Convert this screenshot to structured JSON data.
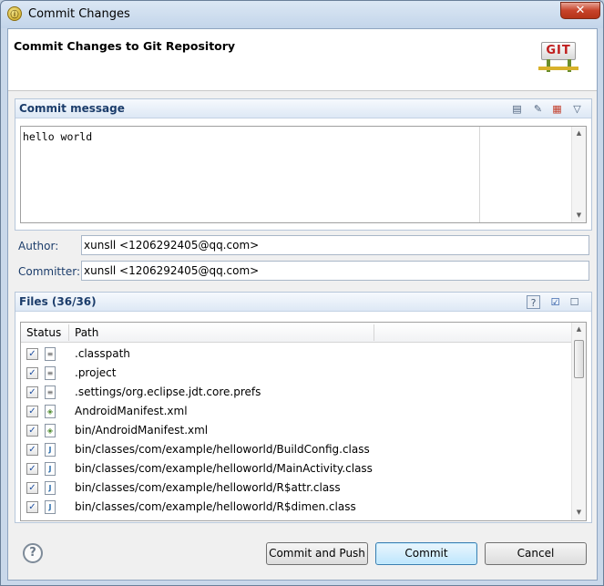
{
  "window": {
    "title": "Commit Changes",
    "close_glyph": "✕"
  },
  "header": {
    "title": "Commit Changes to Git Repository",
    "logo_text": "GIT"
  },
  "commit_message": {
    "section_title": "Commit message",
    "text": "hello world",
    "tools": [
      "spell-check-icon",
      "amend-icon",
      "signoff-icon",
      "menu-chevron-icon"
    ]
  },
  "author": {
    "label": "Author:",
    "value": "xunsll <1206292405@qq.com>"
  },
  "committer": {
    "label": "Committer:",
    "value": "xunsll <1206292405@qq.com>"
  },
  "files": {
    "section_title": "Files (36/36)",
    "columns": [
      "Status",
      "Path"
    ],
    "rows": [
      {
        "path": ".classpath",
        "kind": "txt"
      },
      {
        "path": ".project",
        "kind": "txt"
      },
      {
        "path": ".settings/org.eclipse.jdt.core.prefs",
        "kind": "txt"
      },
      {
        "path": "AndroidManifest.xml",
        "kind": "xml"
      },
      {
        "path": "bin/AndroidManifest.xml",
        "kind": "xml"
      },
      {
        "path": "bin/classes/com/example/helloworld/BuildConfig.class",
        "kind": "cls"
      },
      {
        "path": "bin/classes/com/example/helloworld/MainActivity.class",
        "kind": "cls"
      },
      {
        "path": "bin/classes/com/example/helloworld/R$attr.class",
        "kind": "cls"
      },
      {
        "path": "bin/classes/com/example/helloworld/R$dimen.class",
        "kind": "cls"
      }
    ]
  },
  "buttons": {
    "commit_and_push": "Commit and Push",
    "commit": "Commit",
    "cancel": "Cancel",
    "help": "?"
  },
  "colors": {
    "section_title": "#1c3d6b",
    "default_button": "#bee6fd"
  }
}
